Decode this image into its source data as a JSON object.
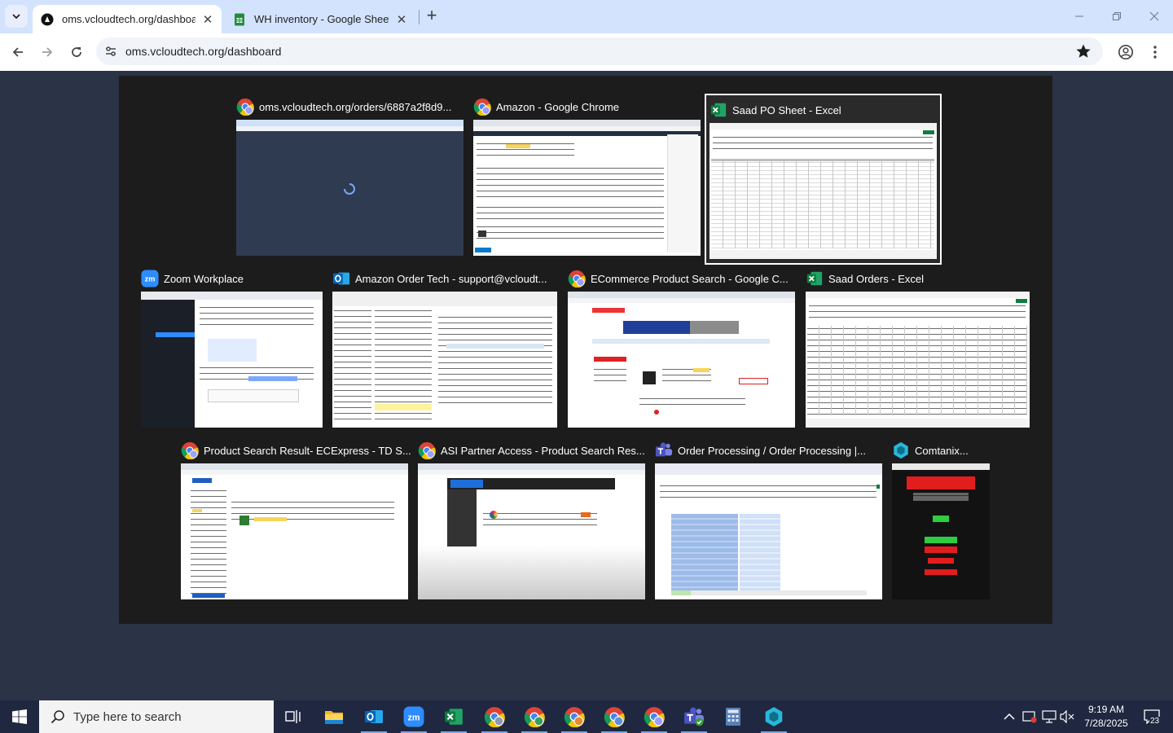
{
  "browser": {
    "tabs": [
      {
        "title": "oms.vcloudtech.org/dashboard",
        "active": true,
        "icon": "vcloud-favicon"
      },
      {
        "title": "WH inventory - Google Sheets",
        "active": false,
        "icon": "sheets-icon"
      }
    ],
    "url": "oms.vcloudtech.org/dashboard"
  },
  "task_view": {
    "windows": [
      {
        "title": "oms.vcloudtech.org/orders/6887a2f8d9...",
        "app": "chrome-icon"
      },
      {
        "title": "Amazon - Google Chrome",
        "app": "chrome-icon"
      },
      {
        "title": "Saad PO Sheet - Excel",
        "app": "excel-icon",
        "selected": true
      },
      {
        "title": "Zoom Workplace",
        "app": "zoom-icon"
      },
      {
        "title": "Amazon Order Tech - support@vcloudt...",
        "app": "outlook-icon"
      },
      {
        "title": "ECommerce Product Search - Google C...",
        "app": "chrome-icon"
      },
      {
        "title": "Saad Orders - Excel",
        "app": "excel-icon"
      },
      {
        "title": "Product Search Result- ECExpress - TD S...",
        "app": "chrome-icon"
      },
      {
        "title": "ASI Partner Access - Product Search Res...",
        "app": "chrome-icon"
      },
      {
        "title": "Order Processing / Order Processing |...",
        "app": "teams-icon"
      },
      {
        "title": "Comtanix...",
        "app": "comtanix-icon"
      }
    ]
  },
  "taskbar": {
    "search_placeholder": "Type here to search",
    "time": "9:19 AM",
    "date": "7/28/2025",
    "notification_count": "23",
    "apps": [
      "task-view-icon",
      "file-explorer-icon",
      "outlook-icon",
      "zoom-icon",
      "excel-icon",
      "chrome-icon",
      "chrome-icon",
      "chrome-icon",
      "chrome-icon",
      "chrome-icon",
      "teams-icon",
      "calculator-icon",
      "comtanix-icon"
    ]
  },
  "colors": {
    "tabstrip": "#d3e3fd",
    "desktop": "#2b3346",
    "taskview": "#1c1c1c",
    "taskbar": "#1f2840"
  }
}
